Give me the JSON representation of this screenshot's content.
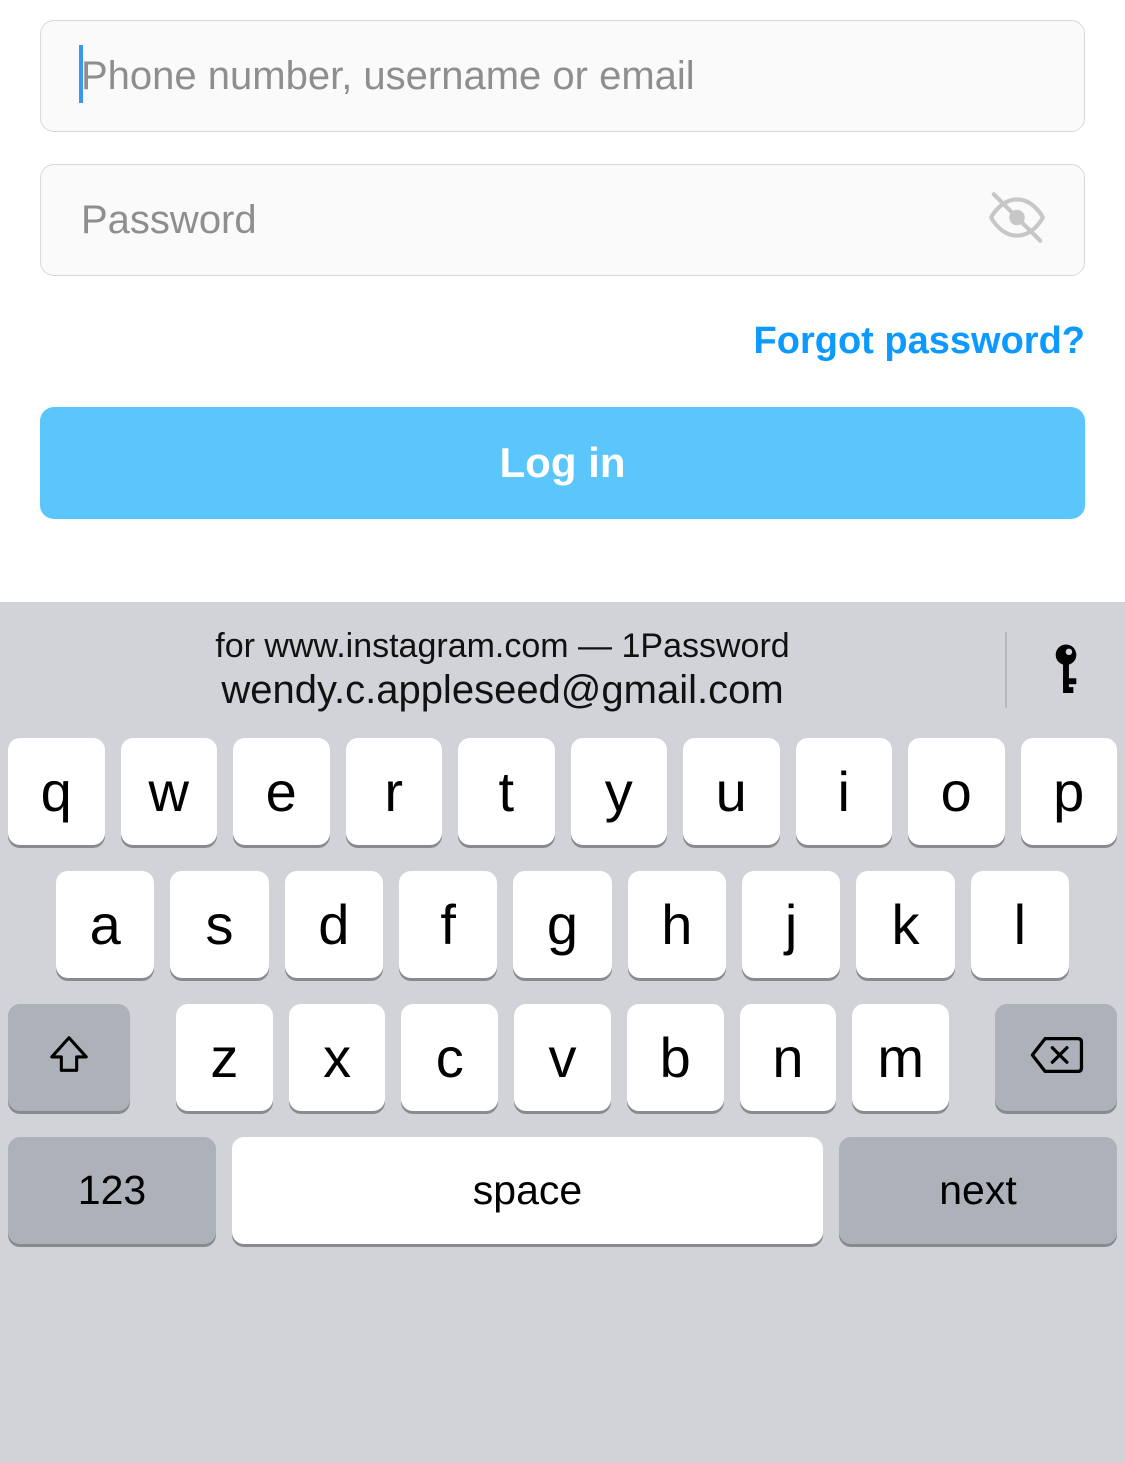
{
  "form": {
    "username_placeholder": "Phone number, username or email",
    "password_placeholder": "Password",
    "forgot_label": "Forgot password?",
    "login_label": "Log in"
  },
  "keyboard": {
    "suggestion_line1": "for www.instagram.com — 1Password",
    "suggestion_line2": "wendy.c.appleseed@gmail.com",
    "row1": [
      "q",
      "w",
      "e",
      "r",
      "t",
      "y",
      "u",
      "i",
      "o",
      "p"
    ],
    "row2": [
      "a",
      "s",
      "d",
      "f",
      "g",
      "h",
      "j",
      "k",
      "l"
    ],
    "row3": [
      "z",
      "x",
      "c",
      "v",
      "b",
      "n",
      "m"
    ],
    "num_label": "123",
    "space_label": "space",
    "next_label": "next"
  }
}
